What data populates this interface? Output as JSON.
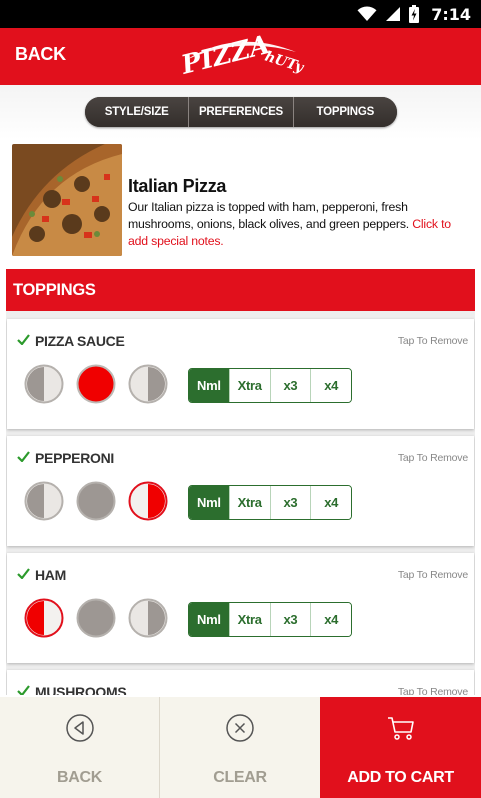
{
  "status_bar": {
    "time": "7:14"
  },
  "header": {
    "back_label": "BACK",
    "logo_text": "PIZZA",
    "logo_subtext": "hUTy"
  },
  "tabs": [
    {
      "label": "STYLE/SIZE"
    },
    {
      "label": "PREFERENCES"
    },
    {
      "label": "TOPPINGS"
    }
  ],
  "product": {
    "title": "Italian Pizza",
    "description": "Our Italian pizza is topped with ham, pepperoni, fresh mushrooms, onions, black olives, and green peppers.",
    "note_link": "Click to add special notes."
  },
  "toppings_section": {
    "title": "TOPPINGS",
    "items": [
      {
        "name": "PIZZA SAUCE",
        "remove_label": "Tap To Remove",
        "portion_selected": "whole",
        "qty_options": [
          "Nml",
          "Xtra",
          "x3",
          "x4"
        ],
        "qty_selected": "Nml"
      },
      {
        "name": "PEPPERONI",
        "remove_label": "Tap To Remove",
        "portion_selected": "right",
        "qty_options": [
          "Nml",
          "Xtra",
          "x3",
          "x4"
        ],
        "qty_selected": "Nml"
      },
      {
        "name": "HAM",
        "remove_label": "Tap To Remove",
        "portion_selected": "left",
        "qty_options": [
          "Nml",
          "Xtra",
          "x3",
          "x4"
        ],
        "qty_selected": "Nml"
      },
      {
        "name": "MUSHROOMS",
        "remove_label": "Tap To Remove"
      }
    ]
  },
  "bottom_bar": {
    "back_label": "BACK",
    "clear_label": "CLEAR",
    "cart_label": "ADD TO CART"
  },
  "colors": {
    "brand_red": "#e1101c",
    "qty_green": "#2c6e2e",
    "tab_dark": "#3b3633"
  }
}
